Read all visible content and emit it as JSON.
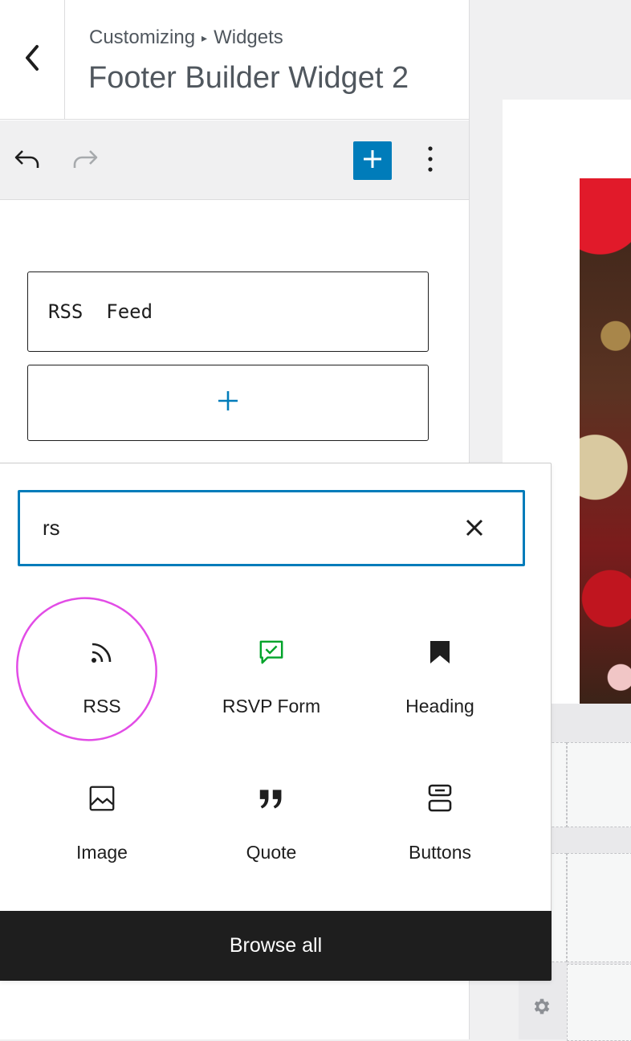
{
  "header": {
    "breadcrumb_parent": "Customizing",
    "breadcrumb_separator": "▸",
    "breadcrumb_current": "Widgets",
    "title": "Footer Builder Widget 2"
  },
  "toolbar": {
    "undo_icon": "undo-icon",
    "redo_icon": "redo-icon",
    "inserter_icon": "plus-icon",
    "options_icon": "more-vertical-icon"
  },
  "editor": {
    "rss_block_label": "RSS  Feed",
    "add_block_icon": "plus-icon"
  },
  "inserter": {
    "search_value": "rs",
    "blocks": [
      {
        "label": "RSS",
        "icon": "rss-icon"
      },
      {
        "label": "RSVP Form",
        "icon": "rsvp-form-icon"
      },
      {
        "label": "Heading",
        "icon": "bookmark-icon"
      },
      {
        "label": "Image",
        "icon": "image-icon"
      },
      {
        "label": "Quote",
        "icon": "quote-icon"
      },
      {
        "label": "Buttons",
        "icon": "buttons-icon"
      }
    ],
    "browse_all_label": "Browse all"
  },
  "colors": {
    "accent": "#007cba",
    "rsvp_icon": "#00a32a",
    "highlight": "#e24ce6",
    "browse_bar": "#1e1e1e"
  }
}
